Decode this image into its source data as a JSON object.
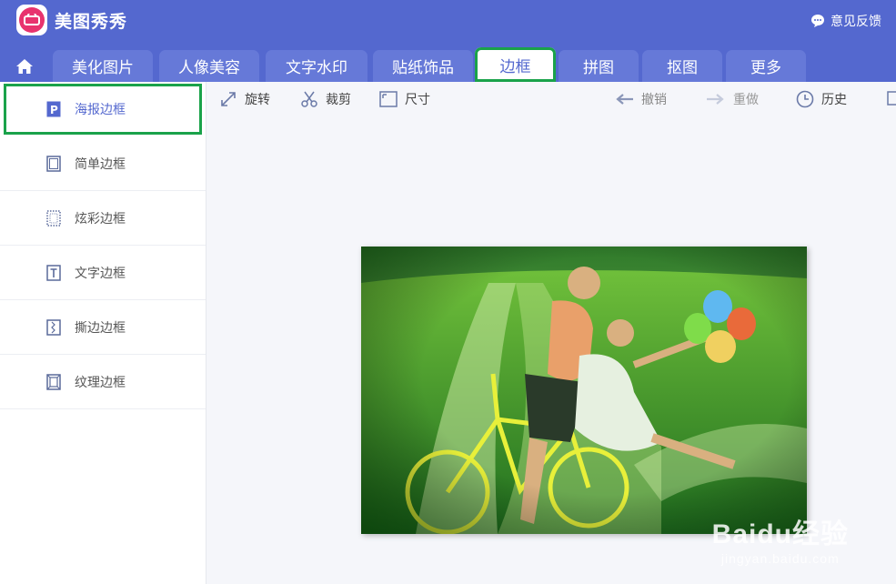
{
  "app": {
    "name": "美图秀秀",
    "feedback": "意见反馈"
  },
  "tabs": [
    {
      "label": "美化图片"
    },
    {
      "label": "人像美容"
    },
    {
      "label": "文字水印"
    },
    {
      "label": "贴纸饰品"
    },
    {
      "label": "边框",
      "active": true
    },
    {
      "label": "拼图"
    },
    {
      "label": "抠图"
    },
    {
      "label": "更多"
    }
  ],
  "sidebar": {
    "items": [
      {
        "label": "海报边框",
        "icon": "poster-frame-icon",
        "selected": true
      },
      {
        "label": "简单边框",
        "icon": "simple-frame-icon"
      },
      {
        "label": "炫彩边框",
        "icon": "dotted-frame-icon"
      },
      {
        "label": "文字边框",
        "icon": "text-frame-icon"
      },
      {
        "label": "撕边边框",
        "icon": "torn-frame-icon"
      },
      {
        "label": "纹理边框",
        "icon": "texture-frame-icon"
      }
    ]
  },
  "toolbar": {
    "rotate": "旋转",
    "crop": "裁剪",
    "size": "尺寸",
    "undo": "撤销",
    "redo": "重做",
    "history": "历史"
  },
  "watermark": {
    "main": "Baidu经验",
    "sub": "jingyan.baidu.com"
  },
  "colors": {
    "header": "#5468cf",
    "tab": "#6679d8",
    "highlight": "#1aa24a"
  }
}
